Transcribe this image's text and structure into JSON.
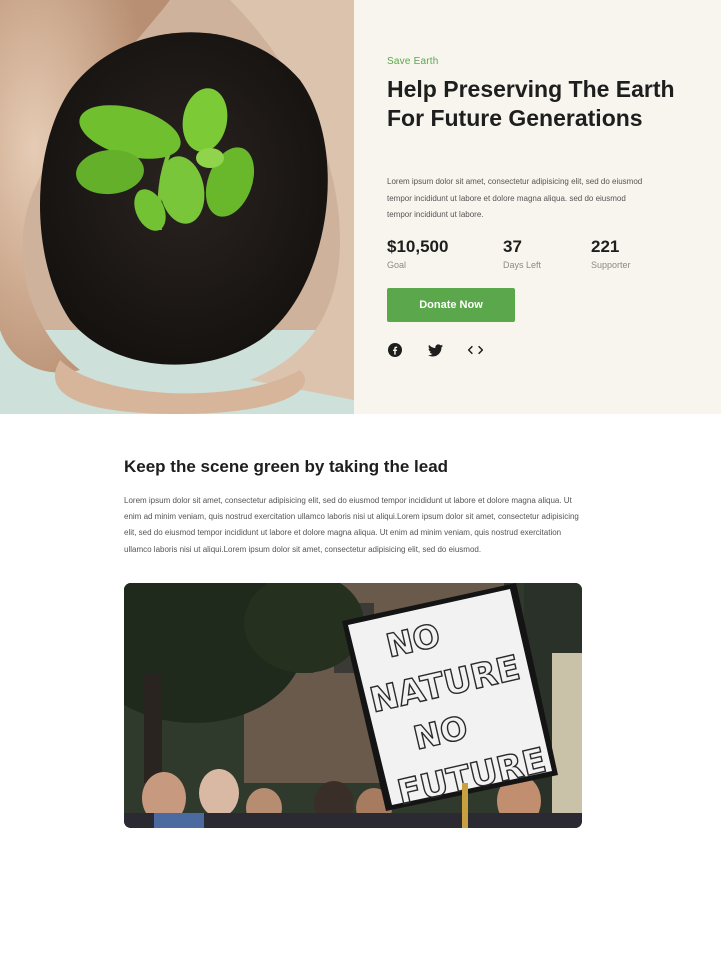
{
  "hero": {
    "eyebrow": "Save Earth",
    "title": "Help Preserving The Earth For Future Generations",
    "description": "Lorem ipsum dolor sit amet, consectetur adipisicing elit, sed do eiusmod tempor incididunt ut labore et dolore magna aliqua. sed do eiusmod tempor incididunt ut labore.",
    "stats": [
      {
        "value": "$10,500",
        "label": "Goal"
      },
      {
        "value": "37",
        "label": "Days Left"
      },
      {
        "value": "221",
        "label": "Supporter"
      }
    ],
    "donate_label": "Donate Now",
    "socials": [
      "facebook-icon",
      "twitter-icon",
      "code-icon"
    ],
    "accent_color": "#5aa84b",
    "panel_bg": "#f8f5ee"
  },
  "section": {
    "title": "Keep the scene green by taking the lead",
    "body": "Lorem ipsum dolor sit amet, consectetur adipisicing elit, sed do eiusmod tempor incididunt ut labore et dolore magna aliqua. Ut enim ad minim veniam, quis nostrud exercitation ullamco laboris nisi ut aliqui.Lorem ipsum dolor sit amet, consectetur adipisicing elit, sed do eiusmod tempor incididunt ut labore et dolore magna aliqua. Ut enim ad minim veniam, quis nostrud exercitation ullamco laboris nisi ut aliqui.Lorem ipsum dolor sit amet, consectetur adipisicing elit, sed do eiusmod.",
    "sign_text": [
      "NO",
      "NATURE",
      "NO",
      "FUTURE"
    ]
  }
}
